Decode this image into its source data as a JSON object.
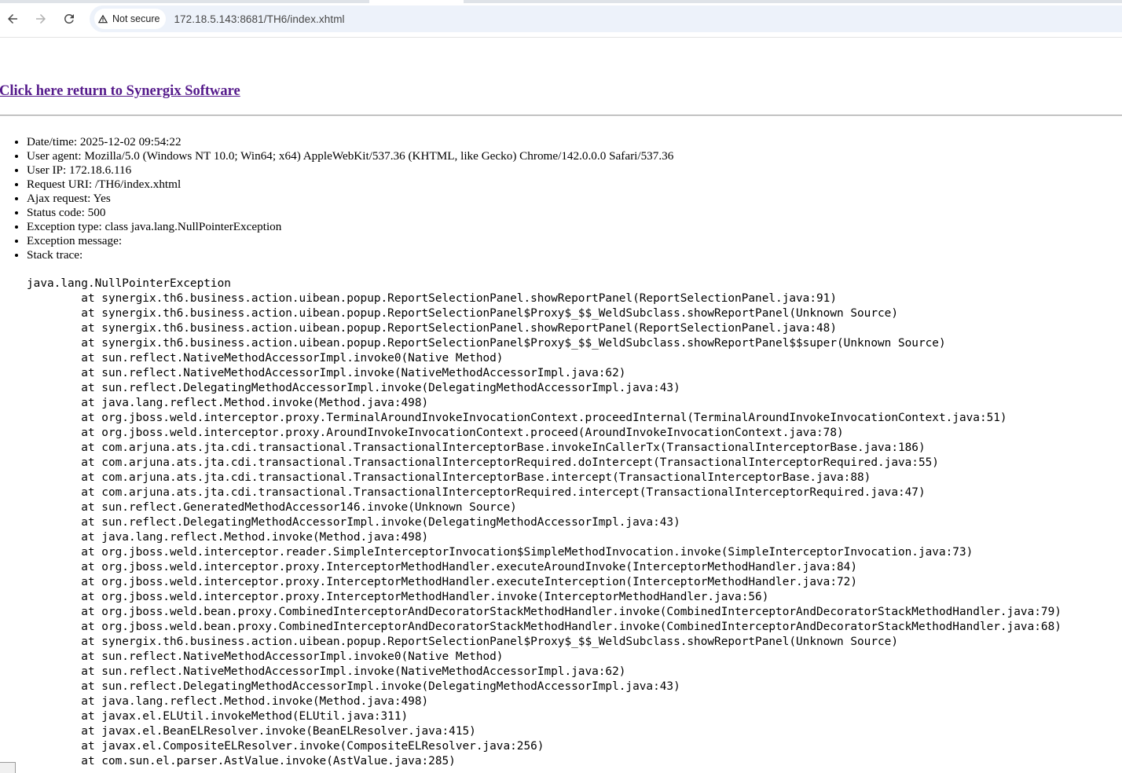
{
  "browser": {
    "security_label": "Not secure",
    "url": "172.18.5.143:8681/TH6/index.xhtml"
  },
  "page": {
    "return_link": "Click here return to Synergix Software",
    "info": [
      {
        "label": "Date/time: ",
        "value": "2025-12-02 09:54:22"
      },
      {
        "label": "User agent: ",
        "value": "Mozilla/5.0 (Windows NT 10.0; Win64; x64) AppleWebKit/537.36 (KHTML, like Gecko) Chrome/142.0.0.0 Safari/537.36"
      },
      {
        "label": "User IP: ",
        "value": "172.18.6.116"
      },
      {
        "label": "Request URI: ",
        "value": "/TH6/index.xhtml"
      },
      {
        "label": "Ajax request: ",
        "value": "Yes"
      },
      {
        "label": "Status code: ",
        "value": "500"
      },
      {
        "label": "Exception type: ",
        "value": "class java.lang.NullPointerException"
      },
      {
        "label": "Exception message: ",
        "value": ""
      },
      {
        "label": "Stack trace: ",
        "value": ""
      }
    ],
    "stack_trace": [
      "java.lang.NullPointerException",
      "\tat synergix.th6.business.action.uibean.popup.ReportSelectionPanel.showReportPanel(ReportSelectionPanel.java:91)",
      "\tat synergix.th6.business.action.uibean.popup.ReportSelectionPanel$Proxy$_$$_WeldSubclass.showReportPanel(Unknown Source)",
      "\tat synergix.th6.business.action.uibean.popup.ReportSelectionPanel.showReportPanel(ReportSelectionPanel.java:48)",
      "\tat synergix.th6.business.action.uibean.popup.ReportSelectionPanel$Proxy$_$$_WeldSubclass.showReportPanel$$super(Unknown Source)",
      "\tat sun.reflect.NativeMethodAccessorImpl.invoke0(Native Method)",
      "\tat sun.reflect.NativeMethodAccessorImpl.invoke(NativeMethodAccessorImpl.java:62)",
      "\tat sun.reflect.DelegatingMethodAccessorImpl.invoke(DelegatingMethodAccessorImpl.java:43)",
      "\tat java.lang.reflect.Method.invoke(Method.java:498)",
      "\tat org.jboss.weld.interceptor.proxy.TerminalAroundInvokeInvocationContext.proceedInternal(TerminalAroundInvokeInvocationContext.java:51)",
      "\tat org.jboss.weld.interceptor.proxy.AroundInvokeInvocationContext.proceed(AroundInvokeInvocationContext.java:78)",
      "\tat com.arjuna.ats.jta.cdi.transactional.TransactionalInterceptorBase.invokeInCallerTx(TransactionalInterceptorBase.java:186)",
      "\tat com.arjuna.ats.jta.cdi.transactional.TransactionalInterceptorRequired.doIntercept(TransactionalInterceptorRequired.java:55)",
      "\tat com.arjuna.ats.jta.cdi.transactional.TransactionalInterceptorBase.intercept(TransactionalInterceptorBase.java:88)",
      "\tat com.arjuna.ats.jta.cdi.transactional.TransactionalInterceptorRequired.intercept(TransactionalInterceptorRequired.java:47)",
      "\tat sun.reflect.GeneratedMethodAccessor146.invoke(Unknown Source)",
      "\tat sun.reflect.DelegatingMethodAccessorImpl.invoke(DelegatingMethodAccessorImpl.java:43)",
      "\tat java.lang.reflect.Method.invoke(Method.java:498)",
      "\tat org.jboss.weld.interceptor.reader.SimpleInterceptorInvocation$SimpleMethodInvocation.invoke(SimpleInterceptorInvocation.java:73)",
      "\tat org.jboss.weld.interceptor.proxy.InterceptorMethodHandler.executeAroundInvoke(InterceptorMethodHandler.java:84)",
      "\tat org.jboss.weld.interceptor.proxy.InterceptorMethodHandler.executeInterception(InterceptorMethodHandler.java:72)",
      "\tat org.jboss.weld.interceptor.proxy.InterceptorMethodHandler.invoke(InterceptorMethodHandler.java:56)",
      "\tat org.jboss.weld.bean.proxy.CombinedInterceptorAndDecoratorStackMethodHandler.invoke(CombinedInterceptorAndDecoratorStackMethodHandler.java:79)",
      "\tat org.jboss.weld.bean.proxy.CombinedInterceptorAndDecoratorStackMethodHandler.invoke(CombinedInterceptorAndDecoratorStackMethodHandler.java:68)",
      "\tat synergix.th6.business.action.uibean.popup.ReportSelectionPanel$Proxy$_$$_WeldSubclass.showReportPanel(Unknown Source)",
      "\tat sun.reflect.NativeMethodAccessorImpl.invoke0(Native Method)",
      "\tat sun.reflect.NativeMethodAccessorImpl.invoke(NativeMethodAccessorImpl.java:62)",
      "\tat sun.reflect.DelegatingMethodAccessorImpl.invoke(DelegatingMethodAccessorImpl.java:43)",
      "\tat java.lang.reflect.Method.invoke(Method.java:498)",
      "\tat javax.el.ELUtil.invokeMethod(ELUtil.java:311)",
      "\tat javax.el.BeanELResolver.invoke(BeanELResolver.java:415)",
      "\tat javax.el.CompositeELResolver.invoke(CompositeELResolver.java:256)",
      "\tat com.sun.el.parser.AstValue.invoke(AstValue.java:285)"
    ]
  }
}
